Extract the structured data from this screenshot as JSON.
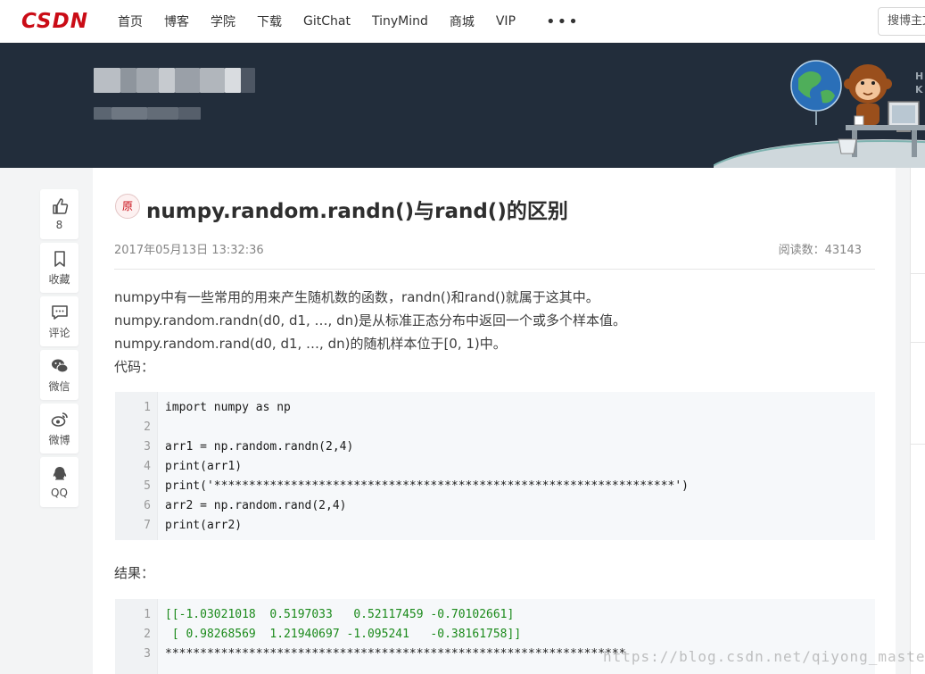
{
  "nav": {
    "logo": "CSDN",
    "items": [
      "首页",
      "博客",
      "学院",
      "下载",
      "GitChat",
      "TinyMind",
      "商城",
      "VIP"
    ],
    "more": "•••",
    "search_placeholder": "搜博主文章"
  },
  "banner": {
    "side_text": [
      "H",
      "K"
    ]
  },
  "sidebar_tools": [
    {
      "icon": "thumbs-up-icon",
      "label": "8"
    },
    {
      "icon": "bookmark-icon",
      "label": "收藏"
    },
    {
      "icon": "comment-icon",
      "label": "评论"
    },
    {
      "icon": "wechat-icon",
      "label": "微信"
    },
    {
      "icon": "weibo-icon",
      "label": "微博"
    },
    {
      "icon": "qq-icon",
      "label": "QQ"
    }
  ],
  "article": {
    "badge": "原",
    "title": "numpy.random.randn()与rand()的区别",
    "date": "2017年05月13日 13:32:36",
    "views": "阅读数：43143",
    "paragraphs": [
      "numpy中有一些常用的用来产生随机数的函数，randn()和rand()就属于这其中。",
      "numpy.random.randn(d0, d1, …, dn)是从标准正态分布中返回一个或多个样本值。",
      "numpy.random.rand(d0, d1, …, dn)的随机样本位于[0, 1)中。",
      "代码："
    ],
    "code1": [
      {
        "n": "1",
        "t": "import numpy as np"
      },
      {
        "n": "2",
        "t": ""
      },
      {
        "n": "3",
        "t": "arr1 = np.random.randn(2,4)"
      },
      {
        "n": "4",
        "t": "print(arr1)"
      },
      {
        "n": "5",
        "t": "print('******************************************************************')"
      },
      {
        "n": "6",
        "t": "arr2 = np.random.rand(2,4)"
      },
      {
        "n": "7",
        "t": "print(arr2)"
      }
    ],
    "result_label": "结果：",
    "code2": [
      {
        "n": "1",
        "t": "[[-1.03021018  0.5197033   0.52117459 -0.70102661]"
      },
      {
        "n": "2",
        "t": " [ 0.98268569  1.21940697 -1.095241   -0.38161758]]"
      },
      {
        "n": "3",
        "t": "******************************************************************"
      }
    ]
  },
  "watermark": "https://blog.csdn.net/qiyong_master",
  "colors": {
    "brand_red": "#ca0c16",
    "banner_bg": "#222d3b",
    "code_bg": "#f6f8fa",
    "output_green": "#1b8a1b"
  }
}
